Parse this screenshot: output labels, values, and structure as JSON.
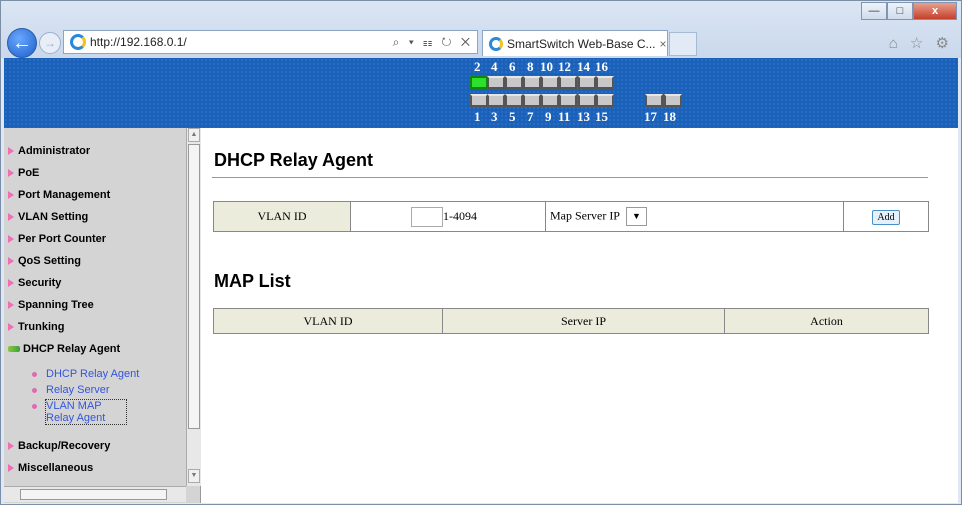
{
  "browser": {
    "url": "http://192.168.0.1/",
    "address_tools": "⌕ ▾ ☷ ↻ ✕",
    "tab_title": "SmartSwitch Web-Base C...",
    "tab_close": "×",
    "window_buttons": {
      "minimize": "—",
      "maximize": "□",
      "close": "x"
    },
    "right_tools": "⌂ ☆ ⚙"
  },
  "ports": {
    "top_labels": [
      "2",
      "4",
      "6",
      "8",
      "10",
      "12",
      "14",
      "16"
    ],
    "bottom_labels": [
      "1",
      "3",
      "5",
      "7",
      "9",
      "11",
      "13",
      "15",
      "17",
      "18"
    ],
    "active_port": "2",
    "link_color": "#2de02d"
  },
  "sidebar": {
    "items": [
      {
        "label": "Administrator"
      },
      {
        "label": "PoE"
      },
      {
        "label": "Port Management"
      },
      {
        "label": "VLAN Setting"
      },
      {
        "label": "Per Port Counter"
      },
      {
        "label": "QoS Setting"
      },
      {
        "label": "Security"
      },
      {
        "label": "Spanning Tree"
      },
      {
        "label": "Trunking"
      },
      {
        "label": "DHCP Relay Agent",
        "expanded": true
      },
      {
        "label": "Backup/Recovery"
      },
      {
        "label": "Miscellaneous"
      }
    ],
    "subitems": [
      {
        "label": "DHCP Relay Agent"
      },
      {
        "label": "Relay Server"
      },
      {
        "label": "VLAN MAP Relay Agent",
        "selected": true
      }
    ]
  },
  "main": {
    "title": "DHCP Relay Agent",
    "form": {
      "vlan_label": "VLAN ID",
      "vlan_value": "",
      "vlan_range": "1-4094",
      "map_label": "Map Server IP",
      "map_value": "",
      "add_label": "Add"
    },
    "list_title": "MAP List",
    "list_headers": [
      "VLAN ID",
      "Server IP",
      "Action"
    ],
    "rows": []
  },
  "colors": {
    "banner": "#1b61b9",
    "sidebar": "#d4d4d4",
    "header_cell": "#ececdc",
    "menu_arrow": "#ef6fb4",
    "link": "#3355dd"
  }
}
